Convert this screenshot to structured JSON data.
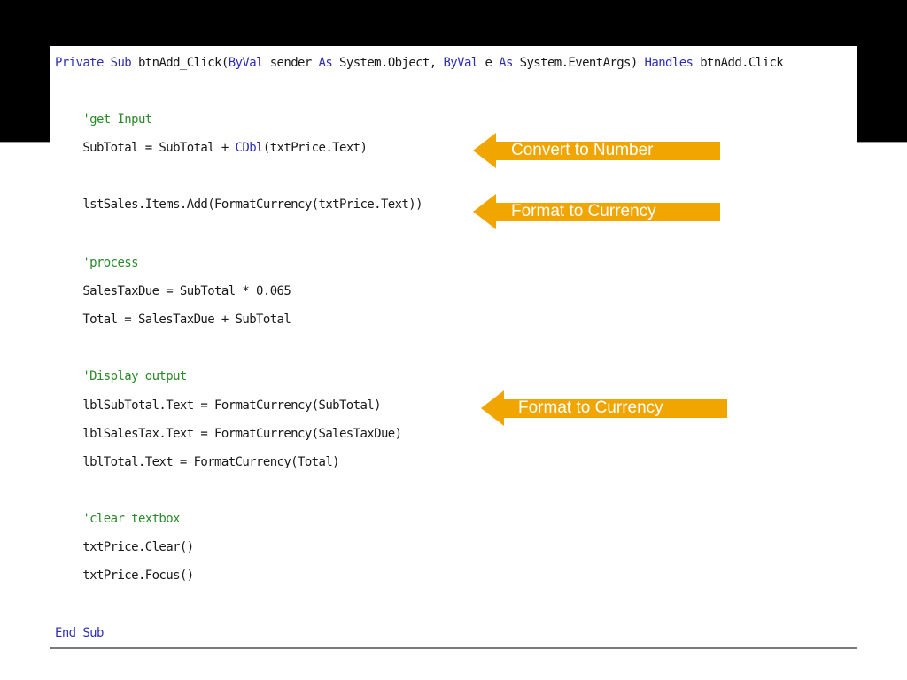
{
  "code": {
    "lines": [
      {
        "parts": [
          {
            "t": "Private Sub",
            "c": "kw"
          },
          {
            "t": " btnAdd_Click(",
            "c": ""
          },
          {
            "t": "ByVal",
            "c": "kw"
          },
          {
            "t": " sender ",
            "c": ""
          },
          {
            "t": "As",
            "c": "kw"
          },
          {
            "t": " System.Object, ",
            "c": ""
          },
          {
            "t": "ByVal",
            "c": "kw"
          },
          {
            "t": " e ",
            "c": ""
          },
          {
            "t": "As",
            "c": "kw"
          },
          {
            "t": " System.EventArgs) ",
            "c": ""
          },
          {
            "t": "Handles",
            "c": "kw"
          },
          {
            "t": " btnAdd.Click",
            "c": ""
          }
        ]
      },
      {
        "parts": [
          {
            "t": "    'get Input",
            "c": "comment"
          }
        ]
      },
      {
        "parts": [
          {
            "t": "    SubTotal = SubTotal + ",
            "c": ""
          },
          {
            "t": "CDbl",
            "c": "kw"
          },
          {
            "t": "(txtPrice.Text)",
            "c": ""
          }
        ]
      },
      {
        "parts": [
          {
            "t": "    lstSales.Items.Add(FormatCurrency(txtPrice.Text))",
            "c": ""
          }
        ]
      },
      {
        "parts": [
          {
            "t": "    'process",
            "c": "comment"
          }
        ]
      },
      {
        "parts": [
          {
            "t": "    SalesTaxDue = SubTotal * 0.065",
            "c": ""
          }
        ]
      },
      {
        "parts": [
          {
            "t": "    Total = SalesTaxDue + SubTotal",
            "c": ""
          }
        ]
      },
      {
        "parts": [
          {
            "t": "    'Display output",
            "c": "comment"
          }
        ]
      },
      {
        "parts": [
          {
            "t": "    lblSubTotal.Text = FormatCurrency(SubTotal)",
            "c": ""
          }
        ]
      },
      {
        "parts": [
          {
            "t": "    lblSalesTax.Text = FormatCurrency(SalesTaxDue)",
            "c": ""
          }
        ]
      },
      {
        "parts": [
          {
            "t": "    lblTotal.Text = FormatCurrency(Total)",
            "c": ""
          }
        ]
      },
      {
        "parts": [
          {
            "t": "    'clear textbox",
            "c": "comment"
          }
        ]
      },
      {
        "parts": [
          {
            "t": "    txtPrice.Clear()",
            "c": ""
          }
        ]
      },
      {
        "parts": [
          {
            "t": "    txtPrice.Focus()",
            "c": ""
          }
        ]
      },
      {
        "parts": [
          {
            "t": "End Sub",
            "c": "kw"
          }
        ]
      }
    ]
  },
  "callouts": [
    {
      "label": "Convert to Number"
    },
    {
      "label": "Format to Currency"
    },
    {
      "label": "Format to Currency"
    }
  ],
  "colors": {
    "keyword": "#2f2fb5",
    "comment": "#2a8a2a",
    "callout": "#f0a500",
    "band": "#000000"
  }
}
